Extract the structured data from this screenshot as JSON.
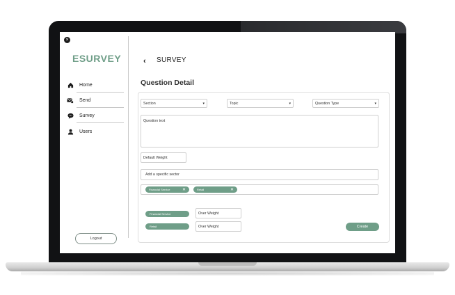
{
  "app": {
    "brand": "ESURVEY",
    "close_glyph": "×"
  },
  "sidebar": {
    "items": [
      {
        "label": "Home",
        "icon": "home-icon"
      },
      {
        "label": "Send",
        "icon": "send-mail-icon"
      },
      {
        "label": "Survey",
        "icon": "chat-bubble-icon"
      },
      {
        "label": "Users",
        "icon": "user-icon"
      }
    ],
    "logout_label": "Logout"
  },
  "header": {
    "back_glyph": "‹",
    "title": "SURVEY"
  },
  "main": {
    "section_title": "Question Detail",
    "selects": {
      "section": "Section",
      "topic": "Topic",
      "question_type": "Question Type",
      "arrow": "▾"
    },
    "question_text_placeholder": "Question text",
    "default_weight_placeholder": "Default Weight",
    "sector_placeholder": "Add a specific sector",
    "chips": [
      {
        "label": "Financial Service",
        "remove": "✕"
      },
      {
        "label": "Retail",
        "remove": "✕"
      }
    ],
    "weights": [
      {
        "sector": "Financial Service",
        "value": "Over Weight"
      },
      {
        "sector": "Retail",
        "value": "Over Weight"
      }
    ],
    "create_label": "Create"
  },
  "colors": {
    "accent": "#6f9e88",
    "bezel": "#111214"
  }
}
